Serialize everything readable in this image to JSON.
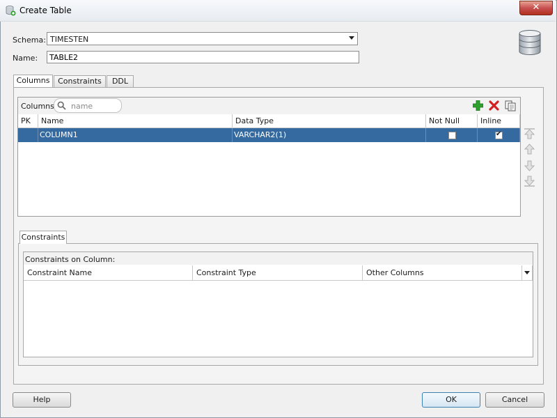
{
  "window": {
    "title": "Create Table",
    "close_glyph": "✕"
  },
  "form": {
    "schema_label": "Schema:",
    "schema_value": "TIMESTEN",
    "name_label": "Name:",
    "name_value": "TABLE2"
  },
  "tabs": [
    {
      "label": "Columns",
      "active": true
    },
    {
      "label": "Constraints",
      "active": false
    },
    {
      "label": "DDL",
      "active": false
    }
  ],
  "columns": {
    "search_label": "Columns:",
    "search_placeholder": "name",
    "toolbar": {
      "add_icon": "add-icon",
      "remove_icon": "remove-icon",
      "copy_icon": "copy-icon"
    },
    "headers": [
      "PK",
      "Name",
      "Data Type",
      "Not Null",
      "Inline"
    ],
    "rows": [
      {
        "pk": "",
        "name": "COLUMN1",
        "data_type": "VARCHAR2(1)",
        "not_null": false,
        "inline": true
      }
    ],
    "move_buttons": [
      "move-top-icon",
      "move-up-icon",
      "move-down-icon",
      "move-bottom-icon"
    ]
  },
  "constraints": {
    "tab_label": "Constraints",
    "section_label": "Constraints on Column:",
    "headers": [
      "Constraint Name",
      "Constraint Type",
      "Other Columns"
    ]
  },
  "buttons": {
    "help": "Help",
    "ok": "OK",
    "cancel": "Cancel"
  },
  "colors": {
    "selection": "#346aa0",
    "add_icon": "#2ea02e",
    "remove_icon": "#d42020"
  }
}
